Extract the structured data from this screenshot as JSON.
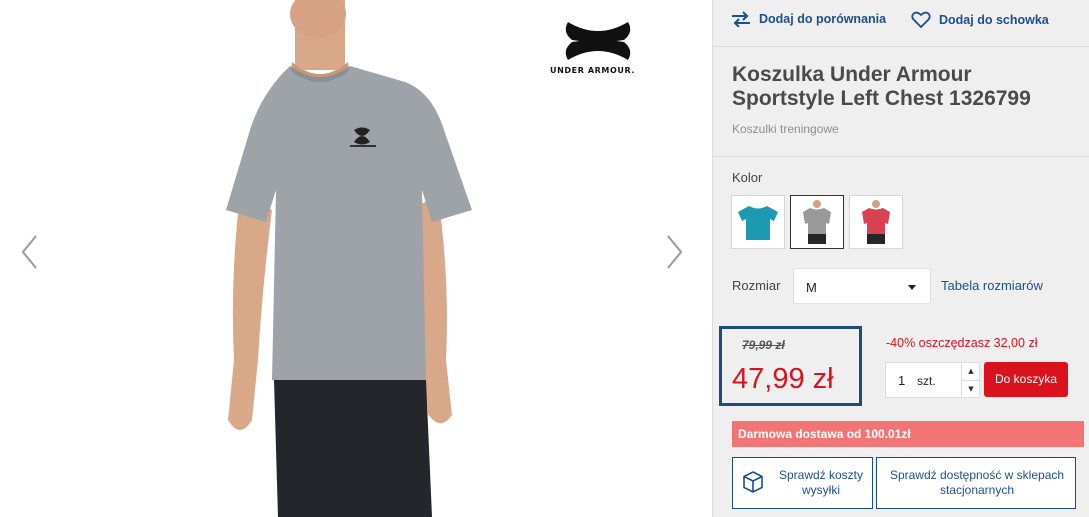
{
  "gallery": {
    "brand_text": "UNDER ARMOUR.",
    "prev_icon": "chevron-left-icon",
    "next_icon": "chevron-right-icon"
  },
  "actions": {
    "compare_label": "Dodaj do porównania",
    "compare_icon": "compare-arrows-icon",
    "wishlist_label": "Dodaj do schowka",
    "wishlist_icon": "heart-icon"
  },
  "product": {
    "title": "Koszulka Under Armour Sportstyle Left Chest 1326799",
    "category": "Koszulki treningowe",
    "color_label": "Kolor",
    "swatches": [
      {
        "color": "#1d9ab2",
        "selected": false
      },
      {
        "color": "#9a9a9a",
        "selected": true
      },
      {
        "color": "#d9434f",
        "selected": false
      }
    ],
    "size_label": "Rozmiar",
    "size_value": "M",
    "size_table_link": "Tabela rozmiarów",
    "old_price": "79,99 zł",
    "new_price": "47,99 zł",
    "discount": "-40% oszczędzasz 32,00 zł",
    "quantity": "1",
    "quantity_unit": "szt.",
    "add_to_cart": "Do koszyka",
    "free_shipping": "Darmowa dostawa od 100.01zł",
    "check_shipping": "Sprawdź koszty wysyłki",
    "check_shipping_icon": "box-icon",
    "check_store": "Sprawdź dostępność w sklepach stacjonarnych"
  },
  "colors": {
    "accent_blue": "#1c4f8d",
    "price_red": "#d9121d",
    "banner_red": "#f27575"
  }
}
